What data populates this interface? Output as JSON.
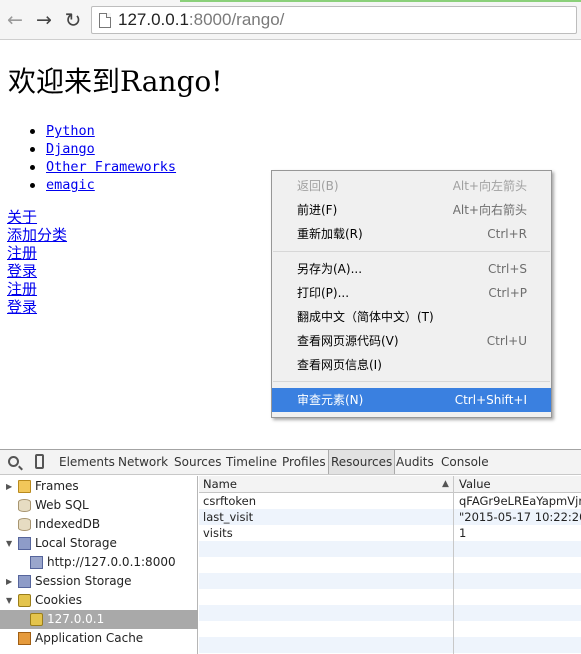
{
  "browser": {
    "back_icon": "arrow-left-icon",
    "forward_icon": "arrow-right-icon",
    "reload_icon": "reload-icon",
    "url_host": "127.0.0.1",
    "url_rest": ":8000/rango/"
  },
  "page": {
    "title": "欢迎来到Rango!",
    "categories": [
      "Python",
      "Django",
      "Other Frameworks",
      "emagic"
    ],
    "links": [
      "关于",
      "添加分类",
      "注册",
      "登录",
      "注册",
      "登录"
    ]
  },
  "context_menu": {
    "items": [
      {
        "label": "返回(B)",
        "shortcut": "Alt+向左箭头",
        "disabled": true
      },
      {
        "label": "前进(F)",
        "shortcut": "Alt+向右箭头"
      },
      {
        "label": "重新加载(R)",
        "shortcut": "Ctrl+R"
      },
      {
        "label": "另存为(A)...",
        "shortcut": "Ctrl+S"
      },
      {
        "label": "打印(P)...",
        "shortcut": "Ctrl+P"
      },
      {
        "label": "翻成中文（简体中文）(T)",
        "shortcut": ""
      },
      {
        "label": "查看网页源代码(V)",
        "shortcut": "Ctrl+U"
      },
      {
        "label": "查看网页信息(I)",
        "shortcut": ""
      },
      {
        "label": "审查元素(N)",
        "shortcut": "Ctrl+Shift+I",
        "highlighted": true
      }
    ]
  },
  "devtools": {
    "tabs": [
      "Elements",
      "Network",
      "Sources",
      "Timeline",
      "Profiles",
      "Resources",
      "Audits",
      "Console"
    ],
    "active_tab": "Resources",
    "tree": [
      {
        "label": "Frames",
        "icon": "folder-icon"
      },
      {
        "label": "Web SQL",
        "icon": "database-icon"
      },
      {
        "label": "IndexedDB",
        "icon": "database-icon"
      },
      {
        "label": "Local Storage",
        "icon": "storage-grid-icon"
      },
      {
        "label": "http://127.0.0.1:8000",
        "icon": "storage-grid-icon"
      },
      {
        "label": "Session Storage",
        "icon": "storage-grid-icon"
      },
      {
        "label": "Cookies",
        "icon": "cookie-icon"
      },
      {
        "label": "127.0.0.1",
        "icon": "cookie-icon",
        "selected": true
      },
      {
        "label": "Application Cache",
        "icon": "app-cache-icon"
      }
    ],
    "table": {
      "columns": [
        "Name",
        "Value"
      ],
      "rows": [
        {
          "name": "csrftoken",
          "value": "qFAGr9eLREaYapmVjra"
        },
        {
          "name": "last_visit",
          "value": "\"2015-05-17 10:22:20.2"
        },
        {
          "name": "visits",
          "value": "1"
        }
      ]
    }
  }
}
